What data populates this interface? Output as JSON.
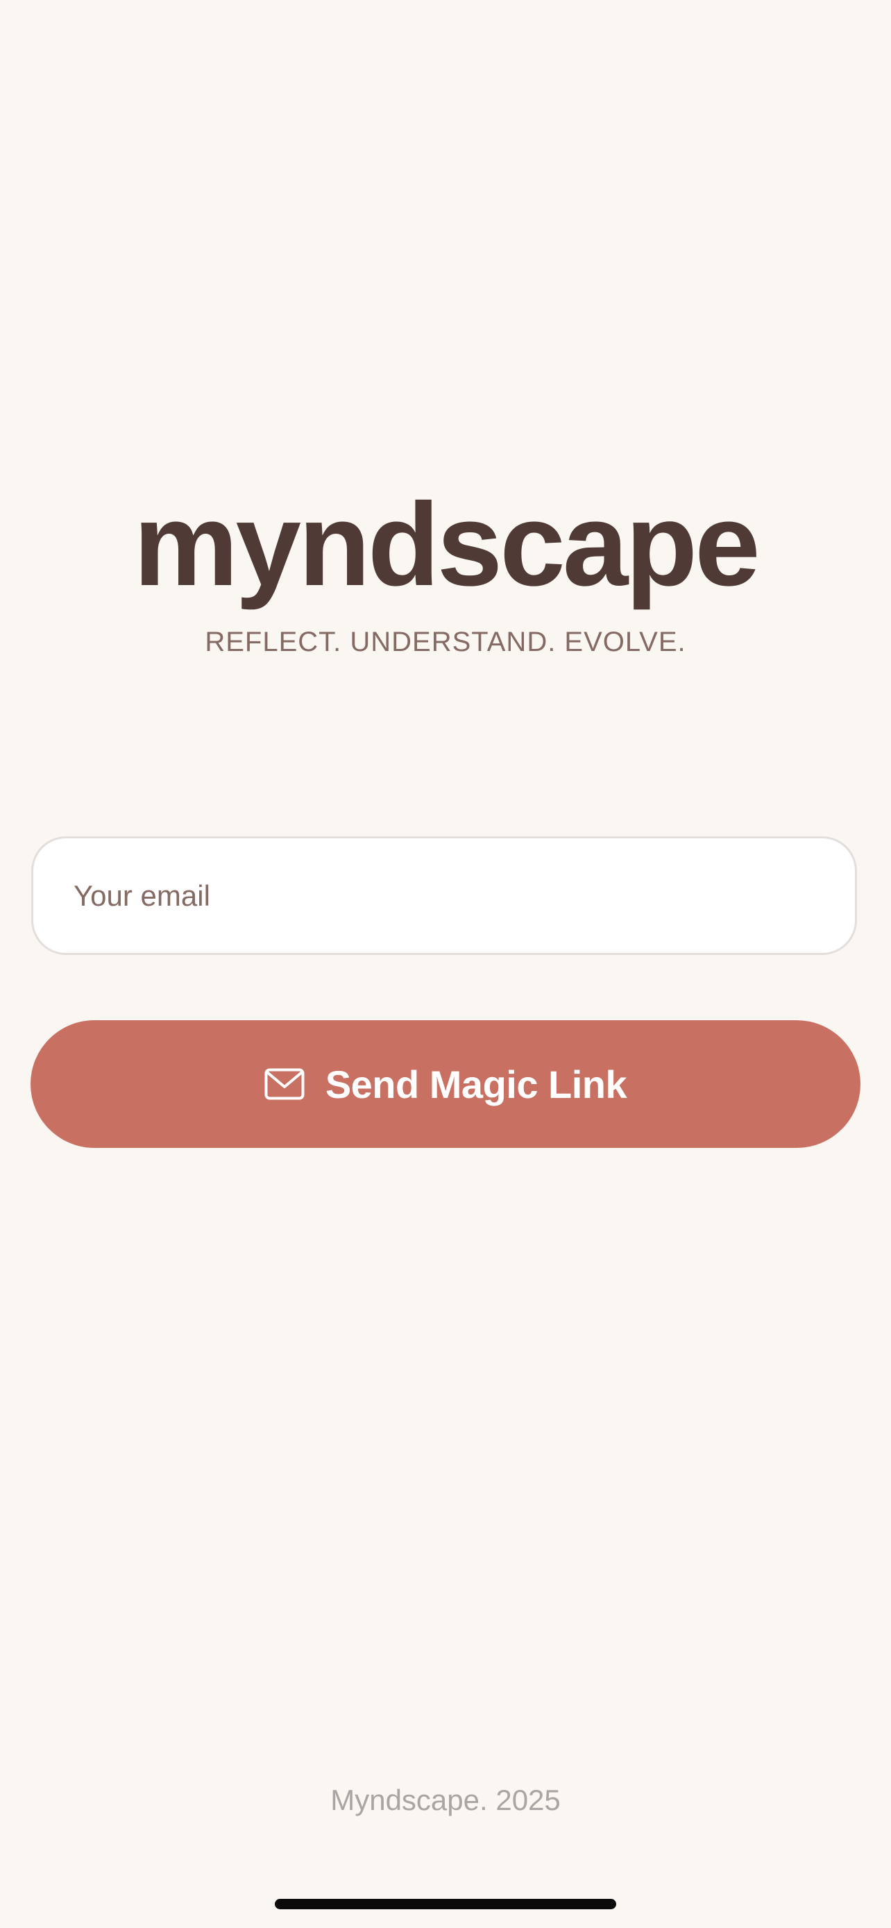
{
  "app": {
    "title": "myndscape",
    "tagline": "REFLECT. UNDERSTAND. EVOLVE."
  },
  "form": {
    "email_placeholder": "Your email",
    "email_value": ""
  },
  "actions": {
    "send_label": "Send Magic Link",
    "send_icon": "envelope-icon"
  },
  "footer": {
    "text": "Myndscape. 2025"
  },
  "colors": {
    "background": "#faf6f2",
    "title": "#4f3a35",
    "tagline": "#856a64",
    "accent_button": "#c87061",
    "footer_text": "#a8a5a4"
  }
}
